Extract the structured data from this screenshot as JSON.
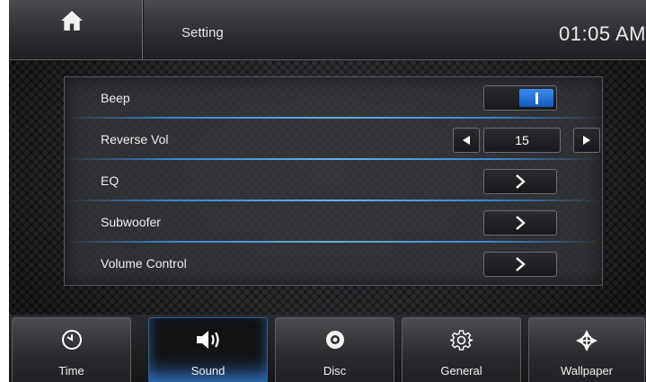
{
  "header": {
    "home_icon": "home-icon",
    "title": "Setting",
    "clock": "01:05 AM"
  },
  "settings": {
    "beep": {
      "label": "Beep",
      "state": "on"
    },
    "reverse_vol": {
      "label": "Reverse Vol",
      "value": "15",
      "decrease_icon": "triangle-left-icon",
      "increase_icon": "triangle-right-icon"
    },
    "eq": {
      "label": "EQ",
      "icon": "chevron-right-icon"
    },
    "subwoofer": {
      "label": "Subwoofer",
      "icon": "chevron-right-icon"
    },
    "volume_control": {
      "label": "Volume Control",
      "icon": "chevron-right-icon"
    }
  },
  "tabs": [
    {
      "label": "Time",
      "icon": "clock-icon",
      "active": false
    },
    {
      "label": "Sound",
      "icon": "speaker-icon",
      "active": true
    },
    {
      "label": "Disc",
      "icon": "disc-icon",
      "active": false
    },
    {
      "label": "General",
      "icon": "gear-icon",
      "active": false
    },
    {
      "label": "Wallpaper",
      "icon": "wallpaper-icon",
      "active": false
    }
  ],
  "colors": {
    "accent": "#3f8fe0",
    "toggle_on": "#2a7ae0"
  }
}
